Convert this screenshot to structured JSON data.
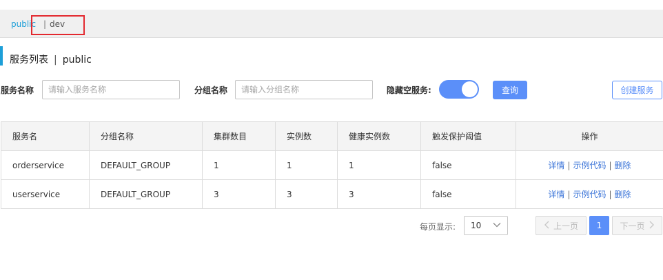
{
  "namespace": {
    "active": "public",
    "separator": "|",
    "other": "dev"
  },
  "page_title": {
    "label": "服务列表",
    "separator": "|",
    "namespace": "public"
  },
  "filters": {
    "service_name_label": "服务名称",
    "service_name_placeholder": "请输入服务名称",
    "group_name_label": "分组名称",
    "group_name_placeholder": "请输入分组名称",
    "hide_empty_label": "隐藏空服务:",
    "hide_empty_on": true,
    "query_button": "查询",
    "create_button": "创建服务"
  },
  "table": {
    "columns": [
      "服务名",
      "分组名称",
      "集群数目",
      "实例数",
      "健康实例数",
      "触发保护阈值",
      "操作"
    ],
    "rows": [
      {
        "service": "orderservice",
        "group": "DEFAULT_GROUP",
        "clusters": "1",
        "instances": "1",
        "healthy": "1",
        "threshold": "false"
      },
      {
        "service": "userservice",
        "group": "DEFAULT_GROUP",
        "clusters": "3",
        "instances": "3",
        "healthy": "3",
        "threshold": "false"
      }
    ],
    "actions": {
      "detail": "详情",
      "sample_code": "示例代码",
      "delete": "删除",
      "separator": "|"
    }
  },
  "pagination": {
    "page_size_label": "每页显示:",
    "page_size": "10",
    "prev": "上一页",
    "current_page": "1",
    "next": "下一页"
  },
  "colors": {
    "accent": "#1d9fd8",
    "primary": "#5b8ff9",
    "highlight_box": "#e3292f"
  }
}
